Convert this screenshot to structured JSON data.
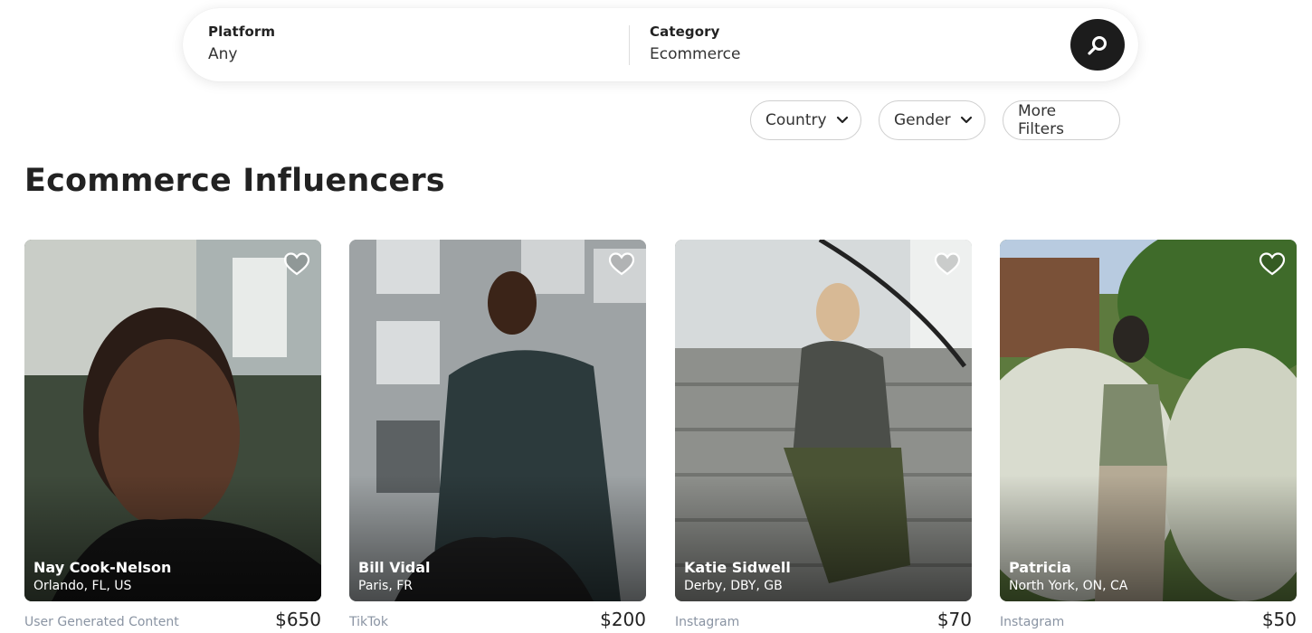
{
  "search": {
    "platform_label": "Platform",
    "platform_value": "Any",
    "category_label": "Category",
    "category_value": "Ecommerce",
    "button_icon": "search-icon"
  },
  "filters": {
    "country": "Country",
    "gender": "Gender",
    "more": "More Filters"
  },
  "page_title": "Ecommerce Influencers",
  "cards": [
    {
      "name": "Nay Cook-Nelson",
      "location": "Orlando, FL, US",
      "platform": "User Generated Content",
      "price": "$650"
    },
    {
      "name": "Bill Vidal",
      "location": "Paris, FR",
      "platform": "TikTok",
      "price": "$200"
    },
    {
      "name": "Katie Sidwell",
      "location": "Derby, DBY, GB",
      "platform": "Instagram",
      "price": "$70"
    },
    {
      "name": "Patricia",
      "location": "North York, ON, CA",
      "platform": "Instagram",
      "price": "$50"
    }
  ],
  "colors": {
    "search_button": "#1c1c1c",
    "platform_text": "#8a94a3",
    "border": "#cfcfcf"
  }
}
